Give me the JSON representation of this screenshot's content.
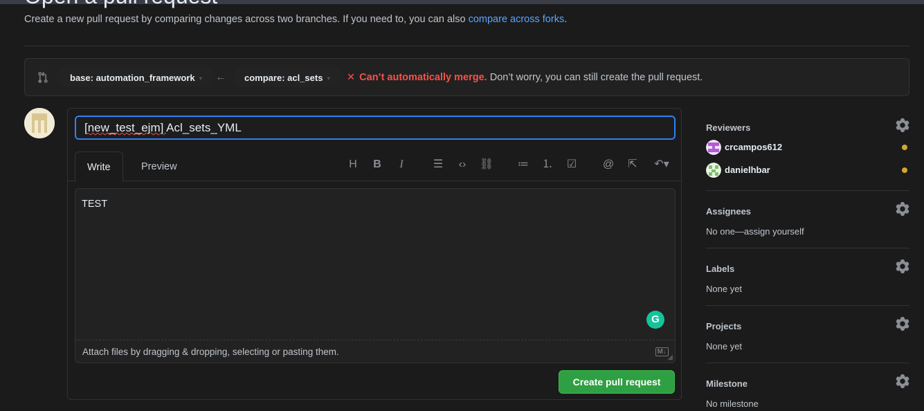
{
  "page": {
    "title": "Open a pull request",
    "subtitle": "Create a new pull request by comparing changes across two branches. If you need to, you can also ",
    "subtitle_link": "compare across forks",
    "subtitle_end": "."
  },
  "compare": {
    "base_label": "base: automation_framework",
    "compare_label": "compare: acl_sets",
    "merge_error": "Can’t automatically merge.",
    "merge_note": "Don’t worry, you can still create the pull request."
  },
  "form": {
    "title_prefix": "[new_test_ejm] ",
    "title_main": "Acl_sets_YML",
    "tabs": [
      "Write",
      "Preview"
    ],
    "body": "TEST",
    "attach_hint": "Attach files by dragging & dropping, selecting or pasting them.",
    "submit_label": "Create pull request"
  },
  "sidebar": {
    "reviewers_label": "Reviewers",
    "reviewers": [
      {
        "name": "crcampos612"
      },
      {
        "name": "danielhbar"
      }
    ],
    "assignees_label": "Assignees",
    "assignees_value": "No one—assign yourself",
    "labels_label": "Labels",
    "labels_value": "None yet",
    "projects_label": "Projects",
    "projects_value": "None yet",
    "milestone_label": "Milestone",
    "milestone_value": "No milestone"
  },
  "colors": {
    "accent_blue": "#58a6ff",
    "error_red": "#f85149",
    "create_green": "#2ea043",
    "pending_yellow": "#d4a72c"
  }
}
